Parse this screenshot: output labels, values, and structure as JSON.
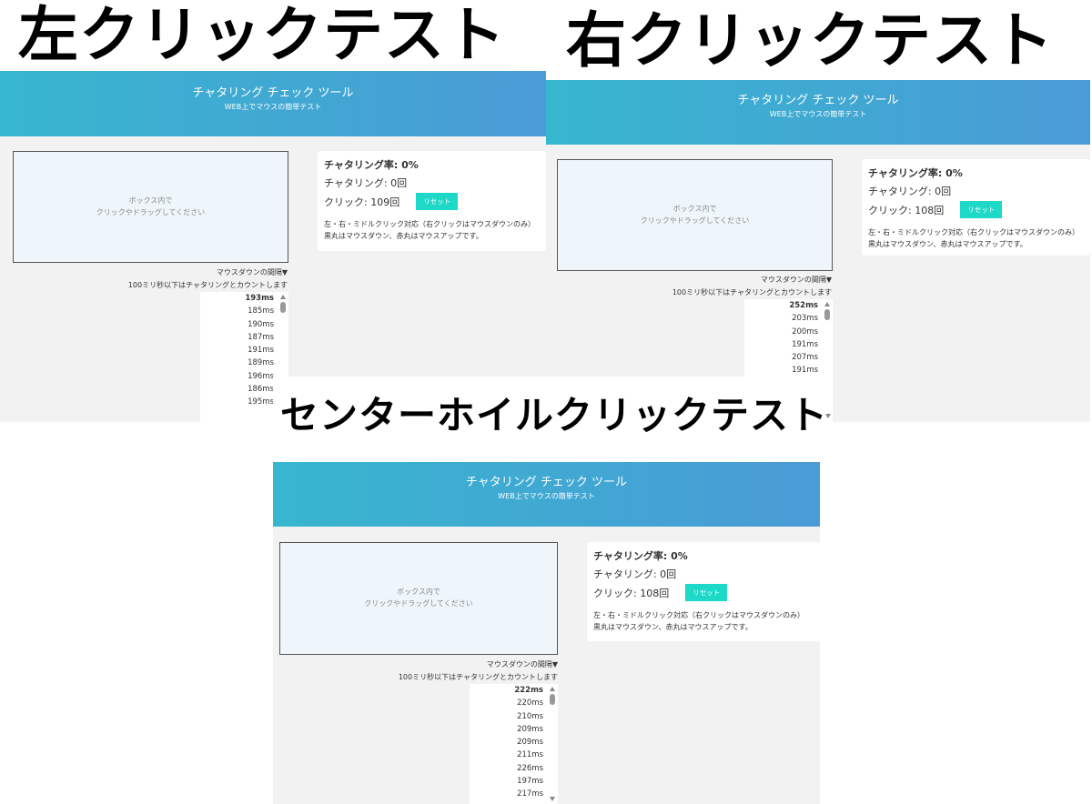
{
  "titles": {
    "left": "左クリックテスト",
    "right": "右クリックテスト",
    "center": "センターホイルクリックテスト"
  },
  "common": {
    "app_title": "チャタリング チェック ツール",
    "app_subtitle": "WEB上でマウスの簡単テスト",
    "box_line1": "ボックス内で",
    "box_line2": "クリックやドラッグしてください",
    "interval_label": "マウスダウンの間隔▼",
    "interval_note": "100ミリ秒以下はチャタリングとカウントします",
    "reset_label": "リセット",
    "note_line1": "左・右・ミドルクリック対応（右クリックはマウスダウンのみ）",
    "note_line2": "黒丸はマウスダウン、赤丸はマウスアップです。"
  },
  "panels": {
    "left": {
      "rate": "チャタリング率: 0%",
      "chatter": "チャタリング: 0回",
      "clicks": "クリック: 109回",
      "intervals": [
        "193ms",
        "185ms",
        "190ms",
        "187ms",
        "191ms",
        "189ms",
        "196ms",
        "186ms",
        "195ms"
      ]
    },
    "right": {
      "rate": "チャタリング率: 0%",
      "chatter": "チャタリング: 0回",
      "clicks": "クリック: 108回",
      "intervals": [
        "252ms",
        "203ms",
        "200ms",
        "191ms",
        "207ms",
        "191ms"
      ]
    },
    "center": {
      "rate": "チャタリング率: 0%",
      "chatter": "チャタリング: 0回",
      "clicks": "クリック: 108回",
      "intervals": [
        "222ms",
        "220ms",
        "210ms",
        "209ms",
        "209ms",
        "211ms",
        "226ms",
        "197ms",
        "217ms"
      ]
    }
  }
}
